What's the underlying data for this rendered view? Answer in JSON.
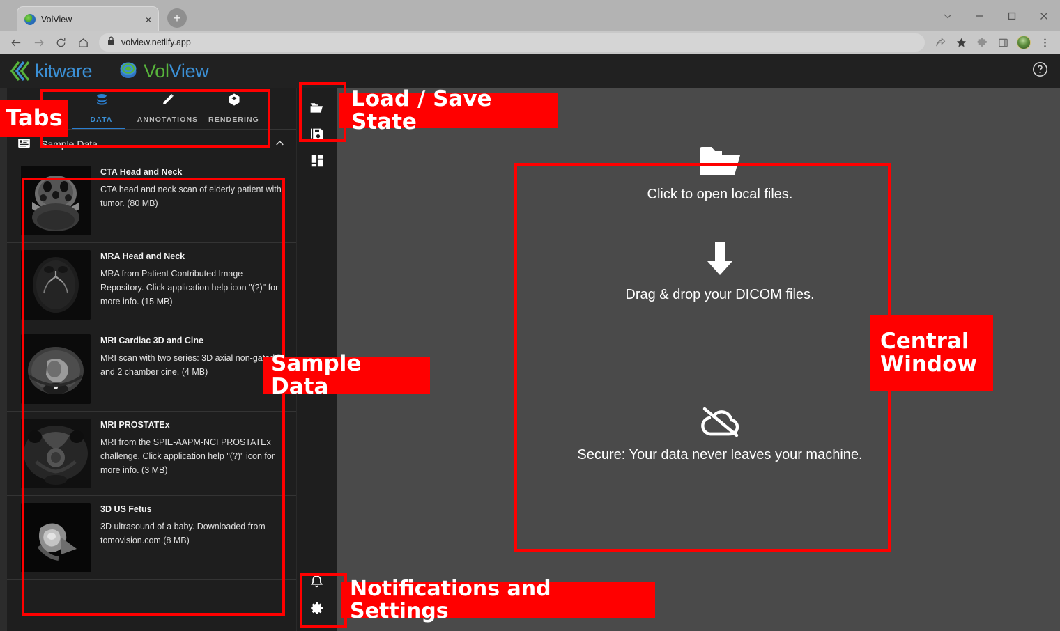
{
  "browser": {
    "tab": {
      "title": "VolView",
      "favicon": "volview-favicon",
      "close": "×"
    },
    "new_tab": "+",
    "url": "volview.netlify.app",
    "window_controls": [
      "chevron-down",
      "minimize",
      "maximize",
      "close"
    ],
    "toolbar_icons": [
      "back",
      "forward",
      "reload",
      "home",
      "lock",
      "share",
      "bookmark-star",
      "extensions-puzzle",
      "side-panel",
      "profile-avatar",
      "menu-kebab"
    ]
  },
  "app": {
    "brand": {
      "kitware": "kitware",
      "volview_vol": "Vol",
      "volview_view": "View"
    },
    "help_icon": "help-circle-icon",
    "tabs": [
      {
        "label": "DATA",
        "icon": "database-icon",
        "active": true
      },
      {
        "label": "ANNOTATIONS",
        "icon": "pencil-icon",
        "active": false
      },
      {
        "label": "RENDERING",
        "icon": "cube-icon",
        "active": false
      }
    ],
    "section": {
      "title": "Sample Data",
      "icon": "list-icon",
      "chevron": "chevron-up-icon"
    },
    "sample_data": [
      {
        "name": "CTA Head and Neck",
        "description": "CTA head and neck scan of elderly patient with tumor. (80 MB)",
        "thumb": "ct-head-axial"
      },
      {
        "name": "MRA Head and Neck",
        "description": "MRA from Patient Contributed Image Repository. Click application help icon \"(?)\" for more info. (15 MB)",
        "thumb": "mra-brain-axial"
      },
      {
        "name": "MRI Cardiac 3D and Cine",
        "description": "MRI scan with two series: 3D axial non-gated and 2 chamber cine. (4 MB)",
        "thumb": "mri-cardiac-axial"
      },
      {
        "name": "MRI PROSTATEx",
        "description": "MRI from the SPIE-AAPM-NCI PROSTATEx challenge. Click application help \"(?)\" icon for more info. (3 MB)",
        "thumb": "mri-prostate-axial"
      },
      {
        "name": "3D US Fetus",
        "description": "3D ultrasound of a baby. Downloaded from tomovision.com.(8 MB)",
        "thumb": "us-fetus"
      }
    ],
    "rail": {
      "top": [
        {
          "name": "open-folder",
          "icon": "folder-open-icon"
        },
        {
          "name": "save-state",
          "icon": "save-disk-icon"
        },
        {
          "name": "layout-grid",
          "icon": "layout-grid-icon"
        }
      ],
      "bottom": [
        {
          "name": "notifications",
          "icon": "bell-icon"
        },
        {
          "name": "settings",
          "icon": "gear-icon"
        }
      ]
    },
    "dropzone": {
      "open_icon": "folder-open-large-icon",
      "open_text": "Click to open local files.",
      "arrow_icon": "arrow-down-icon",
      "drag_text": "Drag & drop your DICOM files.",
      "cloud_icon": "cloud-off-icon",
      "secure_text": "Secure: Your data never leaves your machine."
    }
  },
  "annotations": {
    "accent_color": "#ff0000",
    "labels": [
      {
        "id": "tabs",
        "text": "Tabs"
      },
      {
        "id": "load-save-state",
        "text": "Load / Save State"
      },
      {
        "id": "sample-data",
        "text": "Sample Data"
      },
      {
        "id": "central-window",
        "text": "Central\nWindow"
      },
      {
        "id": "notifications-settings",
        "text": "Notifications and Settings"
      }
    ]
  }
}
